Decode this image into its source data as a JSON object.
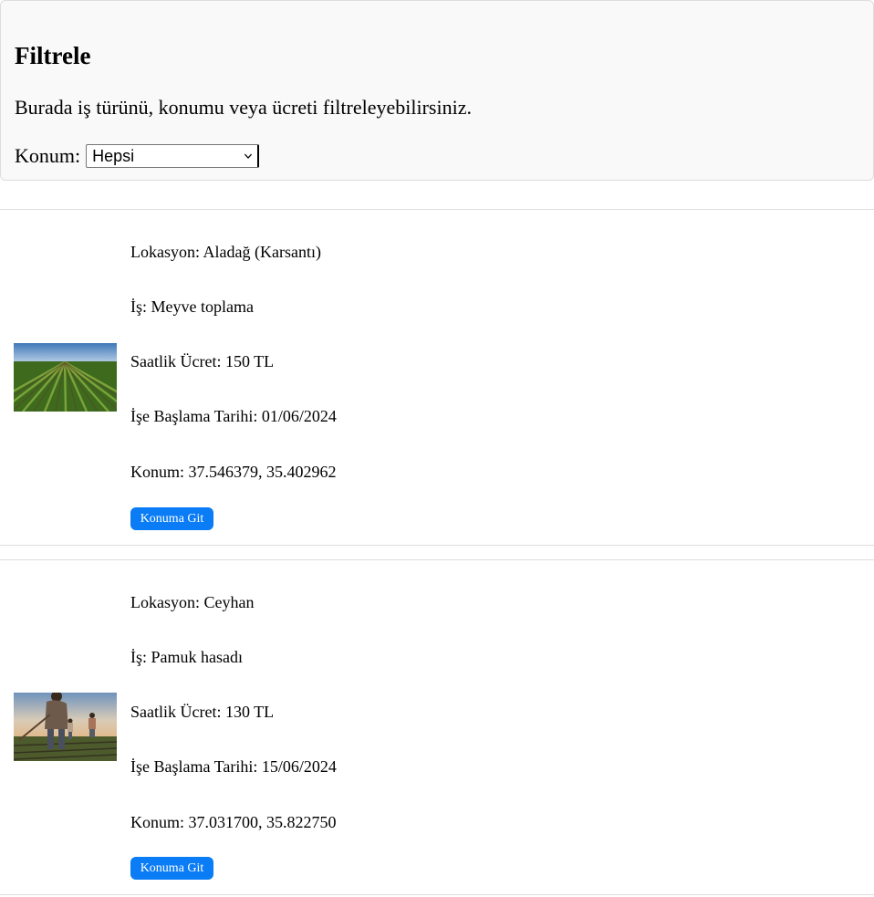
{
  "filter": {
    "title": "Filtrele",
    "description": "Burada iş türünü, konumu veya ücreti filtreleyebilirsiniz.",
    "location_label": "Konum:",
    "location_selected": "Hepsi"
  },
  "jobs": [
    {
      "image_icon": "crop-field-image",
      "location": "Lokasyon: Aladağ (Karsantı)",
      "job": "İş: Meyve toplama",
      "wage": "Saatlik Ücret: 150 TL",
      "start_date": "İşe Başlama Tarihi: 01/06/2024",
      "coords": "Konum: 37.546379, 35.402962",
      "button_label": "Konuma Git"
    },
    {
      "image_icon": "farm-workers-image",
      "location": "Lokasyon: Ceyhan",
      "job": "İş: Pamuk hasadı",
      "wage": "Saatlik Ücret: 130 TL",
      "start_date": "İşe Başlama Tarihi: 15/06/2024",
      "coords": "Konum: 37.031700, 35.822750",
      "button_label": "Konuma Git"
    }
  ],
  "colors": {
    "panel_bg": "#f9f9f9",
    "border": "#dddddd",
    "button": "#0a7cf5"
  }
}
